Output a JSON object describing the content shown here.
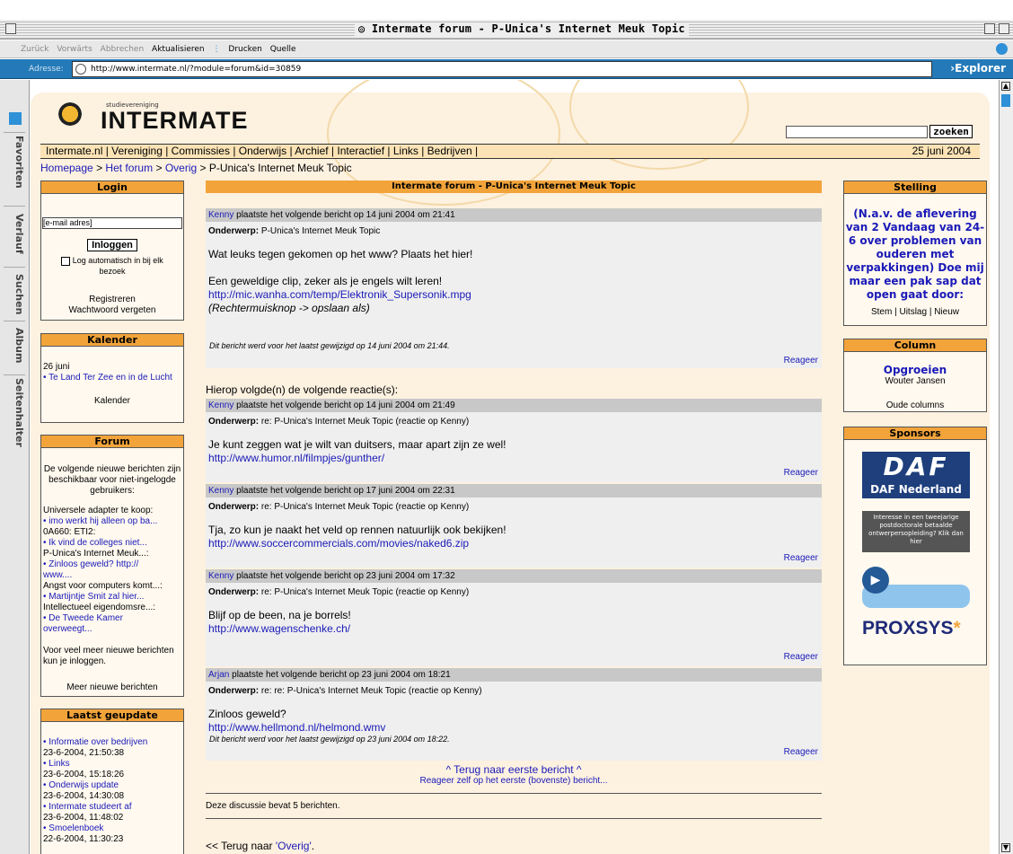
{
  "window": {
    "title": "Intermate forum - P-Unica's Internet Meuk Topic"
  },
  "toolbar": {
    "back": "Zurück",
    "forward": "Vorwärts",
    "stop": "Abbrechen",
    "refresh": "Aktualisieren",
    "print": "Drucken",
    "source": "Quelle"
  },
  "address": {
    "label": "Adresse:",
    "url": "http://www.intermate.nl/?module=forum&id=30859",
    "browser": "Explorer"
  },
  "sidebar_tabs": [
    "Favoriten",
    "Verlauf",
    "Suchen",
    "Album",
    "Seitenhalter"
  ],
  "site": {
    "logo_sub": "studievereniging",
    "logo_name": "INTERMATE",
    "search_button": "zoeken",
    "nav": "Intermate.nl | Vereniging | Commissies | Onderwijs | Archief | Interactief | Links | Bedrijven |",
    "date": "25 juni 2004",
    "crumb": {
      "home": "Homepage",
      "forum": "Het forum",
      "overig": "Overig",
      "current": "> P-Unica's Internet Meuk Topic",
      "sep1": ">",
      "sep2": ">"
    }
  },
  "login": {
    "title": "Login",
    "email_placeholder": "[e-mail adres]",
    "button": "Inloggen",
    "auto": "Log automatisch in bij elk bezoek",
    "register": "Registreren",
    "forgot": "Wachtwoord vergeten"
  },
  "kalender": {
    "title": "Kalender",
    "date": "26 juni",
    "item": "• Te Land Ter Zee en in de Lucht",
    "link": "Kalender"
  },
  "forum": {
    "title": "Forum",
    "intro": "De volgende nieuwe berichten zijn beschikbaar voor niet-ingelogde gebruikers:",
    "items": [
      {
        "topic": "Universele adapter te koop:",
        "link": "• imo werkt hij alleen op ba..."
      },
      {
        "topic": "0A660: ETI2:",
        "link": "• Ik vind de colleges niet..."
      },
      {
        "topic": "P-Unica's Internet Meuk...:",
        "link": "• Zinloos geweld? http:// www...."
      },
      {
        "topic": "Angst voor computers komt...:",
        "link": "• Martijntje Smit zal hier..."
      },
      {
        "topic": "Intellectueel eigendomsre...:",
        "link": "• De Tweede Kamer overweegt..."
      }
    ],
    "more_text": "Voor veel meer nieuwe berichten kun je inloggen.",
    "more_link": "Meer nieuwe berichten"
  },
  "updated": {
    "title": "Laatst geupdate",
    "items": [
      {
        "link": "• Informatie over bedrijven",
        "date": "23-6-2004, 21:50:38"
      },
      {
        "link": "• Links",
        "date": "23-6-2004, 15:18:26"
      },
      {
        "link": "• Onderwijs update",
        "date": "23-6-2004, 14:30:08"
      },
      {
        "link": "• Intermate studeert af",
        "date": "23-6-2004, 11:48:02"
      },
      {
        "link": "• Smoelenboek",
        "date": "22-6-2004, 11:30:23"
      }
    ]
  },
  "main": {
    "title": "Intermate forum - P-Unica's Internet Meuk Topic",
    "first": {
      "author": "Kenny",
      "meta": " plaatste het volgende bericht op 14 juni 2004 om 21:41",
      "subject_label": "Onderwerp:",
      "subject": " P-Unica's Internet Meuk Topic",
      "line1": "Wat leuks tegen gekomen op het www? Plaats het hier!",
      "line2": "Een geweldige clip, zeker als je engels wilt leren!",
      "url": "http://mic.wanha.com/temp/Elektronik_Supersonik.mpg",
      "line3": "(Rechtermuisknop -> opslaan als)",
      "edited": "Dit bericht werd voor het laatst gewijzigd op 14 juni 2004 om 21:44.",
      "reply": "Reageer"
    },
    "reactions_label": "Hierop volgde(n) de volgende reactie(s):",
    "replies": [
      {
        "author": "Kenny",
        "meta": " plaatste het volgende bericht op 14 juni 2004 om 21:49",
        "subject": " re: P-Unica's Internet Meuk Topic (reactie op Kenny)",
        "text": "Je kunt zeggen wat je wilt van duitsers, maar apart zijn ze wel!",
        "url": "http://www.humor.nl/filmpjes/gunther/",
        "reply": "Reageer"
      },
      {
        "author": "Kenny",
        "meta": " plaatste het volgende bericht op 17 juni 2004 om 22:31",
        "subject": " re: P-Unica's Internet Meuk Topic (reactie op Kenny)",
        "text": "Tja, zo kun je naakt het veld op rennen natuurlijk ook bekijken!",
        "url": "http://www.soccercommercials.com/movies/naked6.zip",
        "reply": "Reageer"
      },
      {
        "author": "Kenny",
        "meta": " plaatste het volgende bericht op 23 juni 2004 om 17:32",
        "subject": " re: P-Unica's Internet Meuk Topic (reactie op Kenny)",
        "text": "Blijf op de been, na je borrels!",
        "url": "http://www.wagenschenke.ch/",
        "reply": "Reageer"
      },
      {
        "author": "Arjan",
        "meta": " plaatste het volgende bericht op 23 juni 2004 om 18:21",
        "subject": " re: re: P-Unica's Internet Meuk Topic (reactie op Kenny)",
        "text": "Zinloos geweld?",
        "url": "http://www.hellmond.nl/helmond.wmv",
        "edited": "Dit bericht werd voor het laatst gewijzigd op 23 juni 2004 om 18:22.",
        "reply": "Reageer"
      }
    ],
    "back_first": "^ Terug naar eerste bericht ^",
    "reply_first": "Reageer zelf op het eerste (bovenste) bericht...",
    "count": "Deze discussie bevat 5 berichten.",
    "back_prefix": "<< Terug naar ",
    "back_link": "'Overig'",
    "back_suffix": "."
  },
  "stelling": {
    "title": "Stelling",
    "text": "(N.a.v. de aflevering van 2 Vandaag van 24-6 over problemen van ouderen met verpakkingen) Doe mij maar een pak sap dat open gaat door:",
    "links": "Stem | Uitslag | Nieuw"
  },
  "column": {
    "title": "Column",
    "headline": "Opgroeien",
    "author": "Wouter Jansen",
    "link": "Oude columns"
  },
  "sponsors": {
    "title": "Sponsors",
    "daf": "DAF Nederland",
    "daf_logo": "DAF",
    "ad": "Interesse in een tweejarige postdoctorale betaalde ontwerpersopleiding? Klik dan hier",
    "proxsys": "PROXSYS"
  }
}
